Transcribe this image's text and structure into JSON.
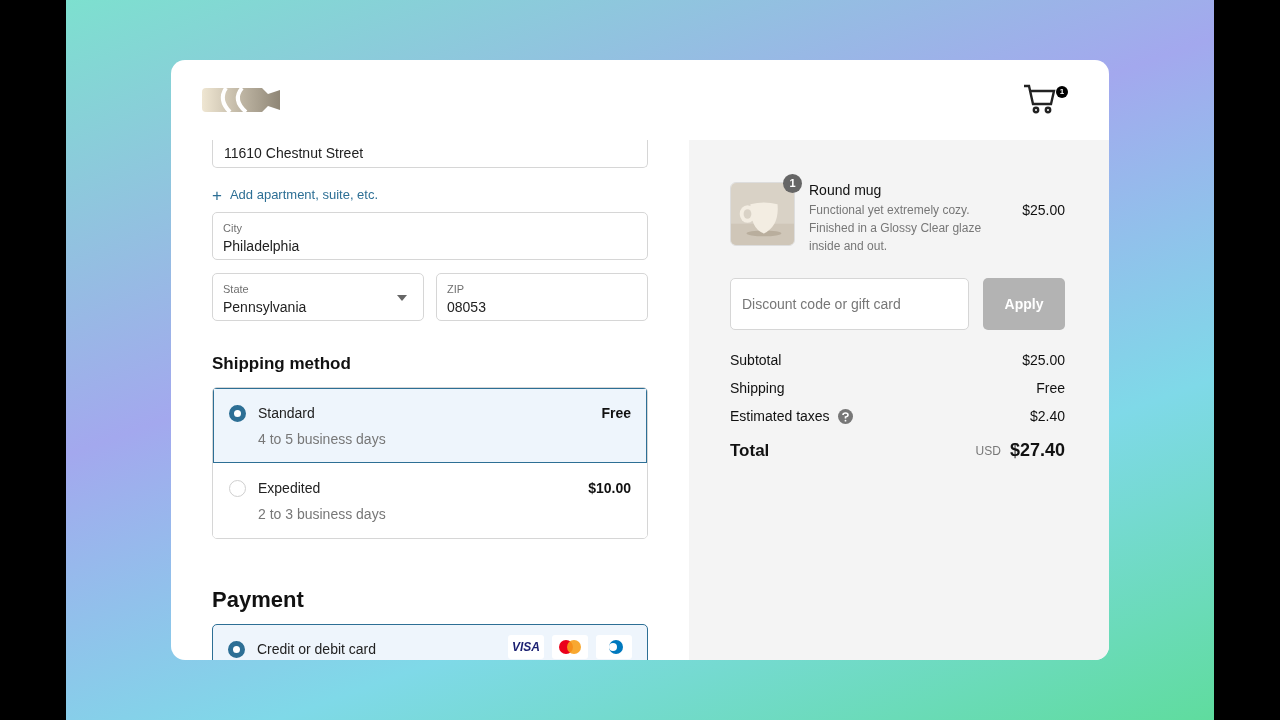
{
  "header": {
    "cart_count": "1"
  },
  "address": {
    "street": "11610 Chestnut Street",
    "add_link_icon": "+",
    "add_link": "Add apartment, suite, etc.",
    "fields": [
      {
        "label": "City",
        "value": "Philadelphia",
        "kind": "text"
      },
      {
        "label": "State",
        "value": "Pennsylvania",
        "kind": "select"
      },
      {
        "label": "ZIP",
        "value": "08053",
        "kind": "text"
      }
    ]
  },
  "shipping": {
    "title": "Shipping method",
    "options": [
      {
        "name": "Standard",
        "detail": "4 to 5 business days",
        "price": "Free",
        "selected": true
      },
      {
        "name": "Expedited",
        "detail": "2 to 3 business days",
        "price": "$10.00",
        "selected": false
      }
    ]
  },
  "payment": {
    "title": "Payment",
    "options": [
      {
        "name": "Credit or debit card",
        "selected": true,
        "card_brands": [
          {
            "kind": "visa",
            "label": "VISA"
          },
          {
            "kind": "mastercard"
          },
          {
            "kind": "diners"
          }
        ]
      }
    ]
  },
  "order": {
    "items": [
      {
        "name": "Round mug",
        "description": "Functional yet extremely cozy. Finished in a Glossy Clear glaze inside and out.",
        "quantity": "1",
        "price": "$25.00"
      }
    ],
    "discount": {
      "placeholder": "Discount code or gift card",
      "button": "Apply",
      "disabled": true
    },
    "summary": [
      {
        "label": "Subtotal",
        "value": "$25.00",
        "info": false
      },
      {
        "label": "Shipping",
        "value": "Free",
        "info": false
      },
      {
        "label": "Estimated taxes",
        "value": "$2.40",
        "info": true
      }
    ],
    "total": {
      "label": "Total",
      "currency": "USD",
      "value": "$27.40"
    }
  }
}
